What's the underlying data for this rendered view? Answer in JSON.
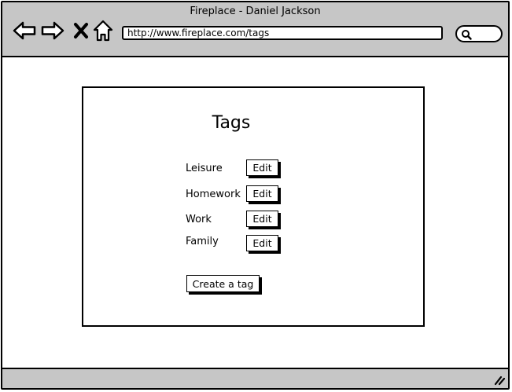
{
  "window": {
    "title": "Fireplace - Daniel Jackson"
  },
  "toolbar": {
    "back_icon": "back-arrow-icon",
    "forward_icon": "forward-arrow-icon",
    "stop_icon": "close-icon",
    "home_icon": "home-icon",
    "search_icon": "search-icon"
  },
  "address": {
    "url": "http://www.fireplace.com/tags"
  },
  "tags_page": {
    "title": "Tags",
    "tags": [
      {
        "label": "Leisure",
        "edit_label": "Edit"
      },
      {
        "label": "Homework",
        "edit_label": "Edit"
      },
      {
        "label": "Work",
        "edit_label": "Edit"
      },
      {
        "label": "Family",
        "edit_label": "Edit"
      }
    ],
    "create_label": "Create a tag"
  },
  "colors": {
    "chrome": "#c6c6c6",
    "border": "#000000",
    "background": "#ffffff"
  }
}
